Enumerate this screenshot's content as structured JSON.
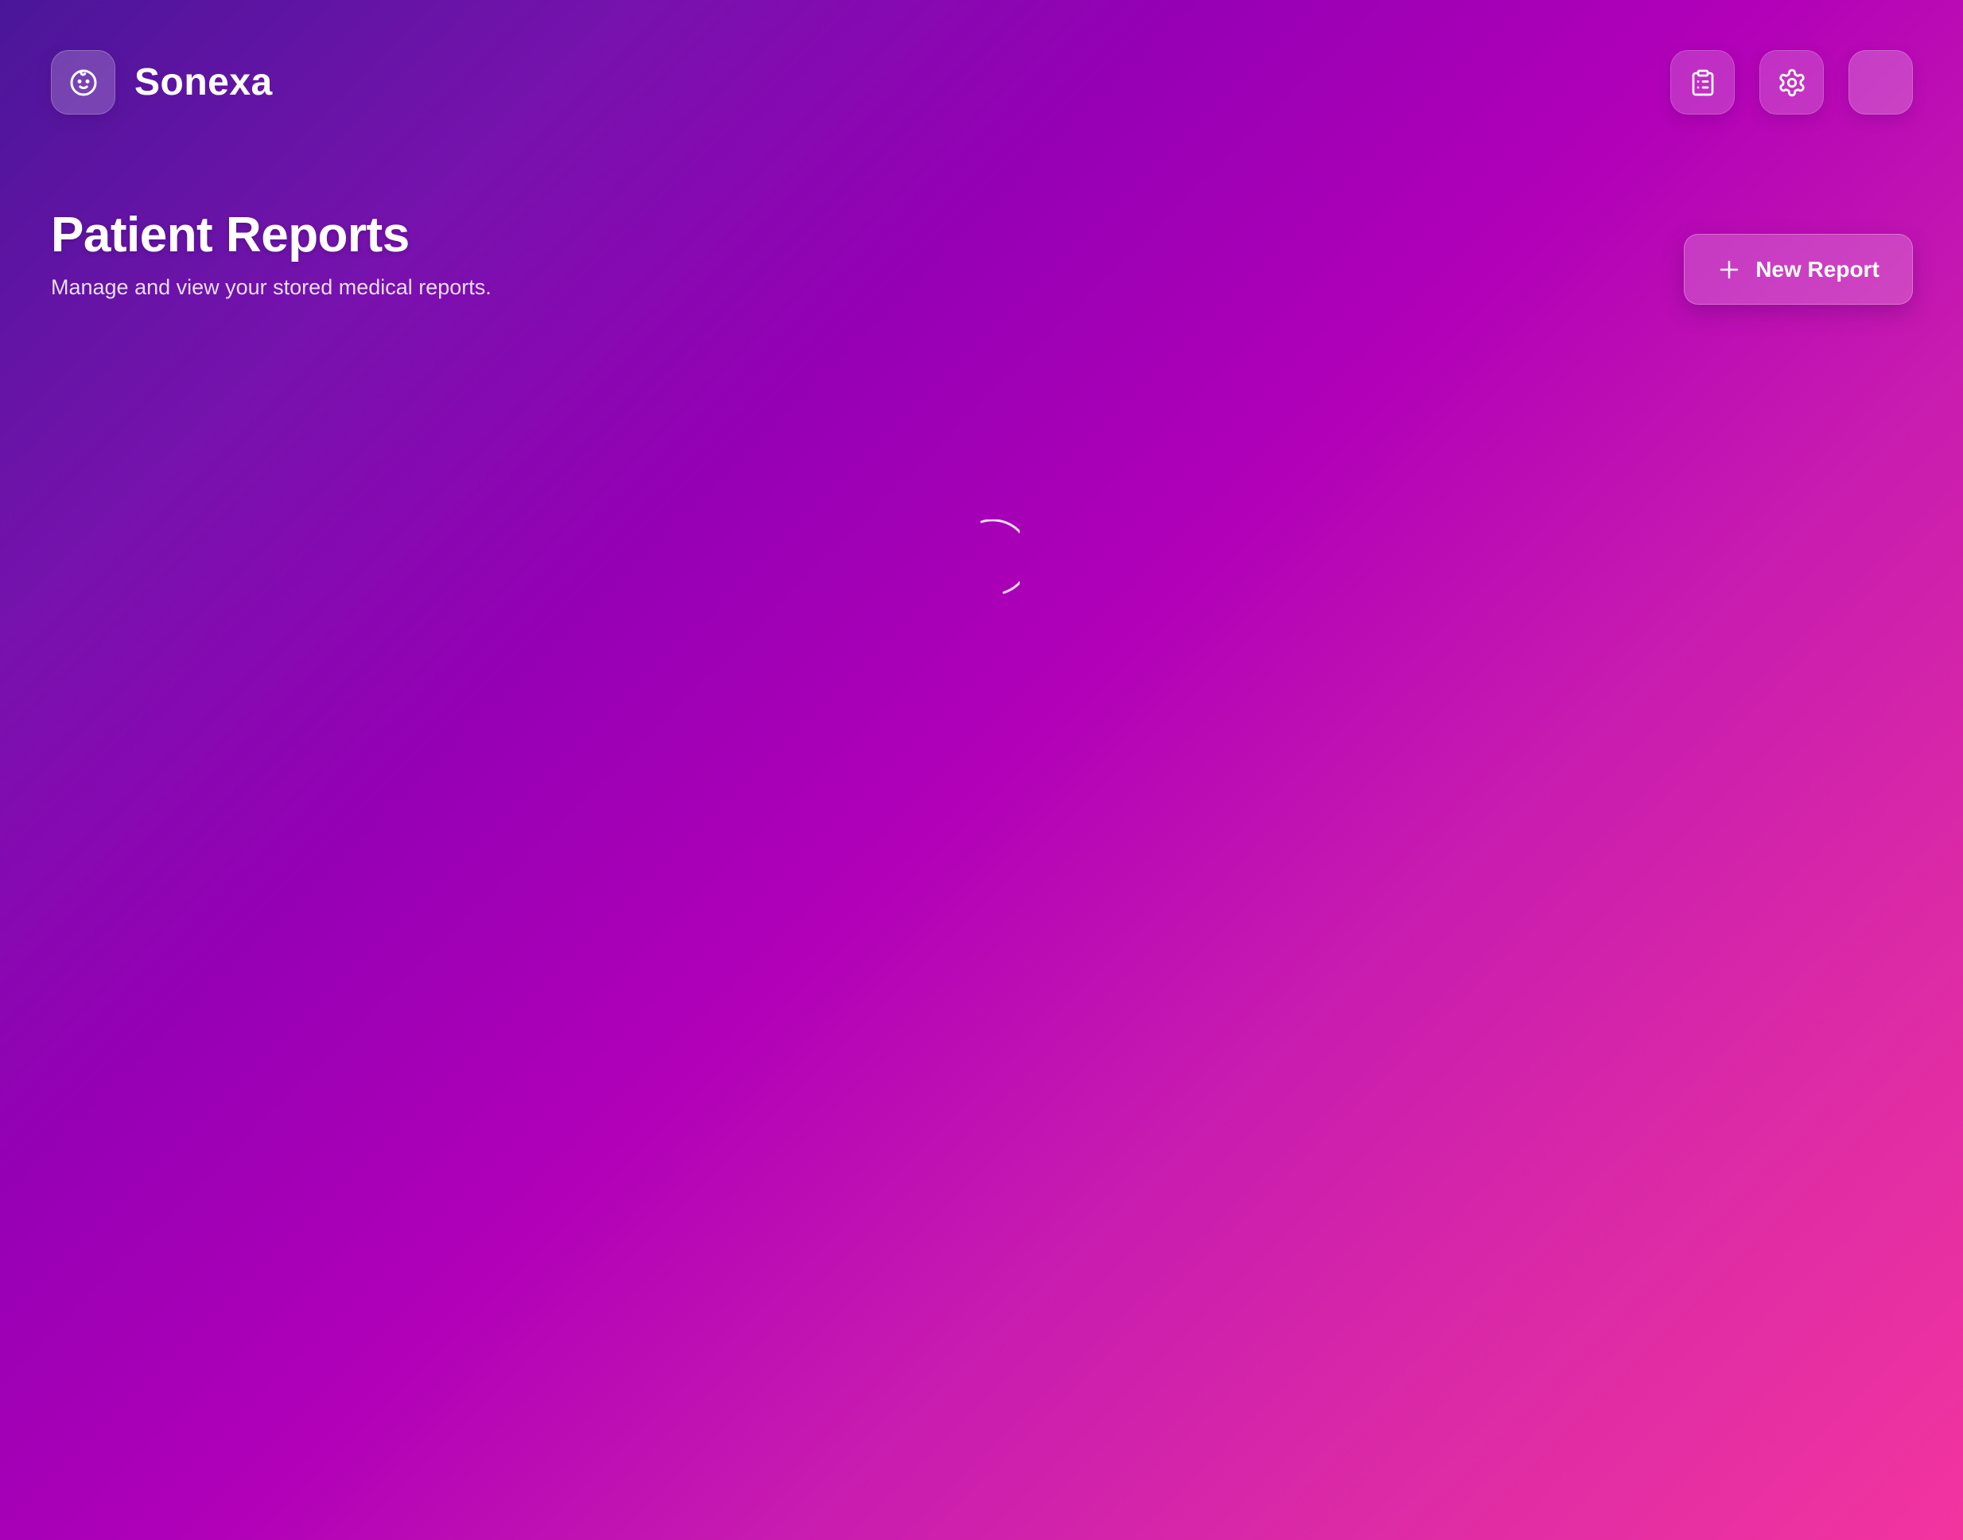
{
  "app": {
    "name": "Sonexa",
    "logo_icon": "baby-face-icon"
  },
  "header": {
    "actions": [
      {
        "name": "reports",
        "icon": "clipboard-list-icon"
      },
      {
        "name": "settings",
        "icon": "gear-icon"
      },
      {
        "name": "profile",
        "icon": "avatar"
      }
    ]
  },
  "page": {
    "title": "Patient Reports",
    "subtitle": "Manage and view your stored medical reports."
  },
  "new_report_button": {
    "label": "New Report",
    "icon": "plus-icon"
  },
  "status": {
    "state": "loading",
    "indicator": "loading-spinner"
  },
  "colors": {
    "gradient_start": "#4a1699",
    "gradient_mid": "#b100b8",
    "gradient_end": "#f2349f",
    "text": "#ffffff"
  }
}
